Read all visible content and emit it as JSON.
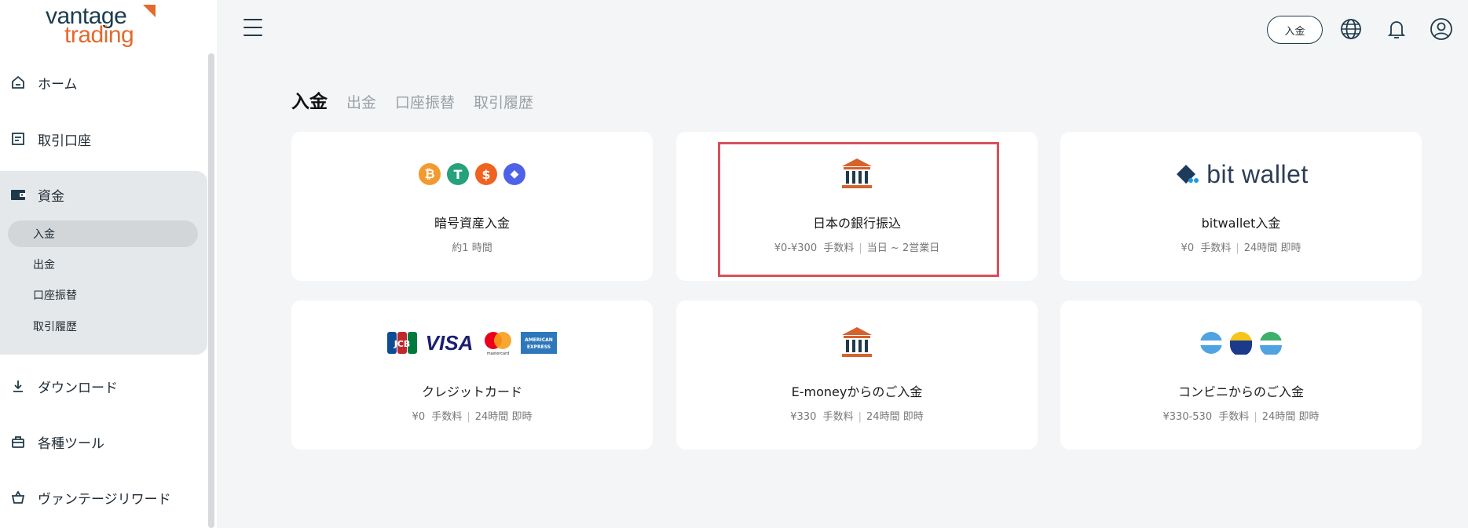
{
  "logo": {
    "line1": "vantage",
    "line2": "trading"
  },
  "sidebar": {
    "items": [
      {
        "label": "ホーム",
        "icon": "home-icon"
      },
      {
        "label": "取引口座",
        "icon": "account-icon"
      },
      {
        "label": "資金",
        "icon": "wallet-icon"
      },
      {
        "label": "ダウンロード",
        "icon": "download-icon"
      },
      {
        "label": "各種ツール",
        "icon": "toolbox-icon"
      },
      {
        "label": "ヴァンテージリワード",
        "icon": "basket-icon"
      }
    ],
    "sub_items": [
      {
        "label": "入金",
        "active": true
      },
      {
        "label": "出金",
        "active": false
      },
      {
        "label": "口座振替",
        "active": false
      },
      {
        "label": "取引履歴",
        "active": false
      }
    ]
  },
  "header": {
    "deposit_button": "入金",
    "icons": [
      "menu-icon",
      "globe-icon",
      "bell-icon",
      "user-icon"
    ]
  },
  "tabs": [
    {
      "label": "入金",
      "active": true
    },
    {
      "label": "出金",
      "active": false
    },
    {
      "label": "口座振替",
      "active": false
    },
    {
      "label": "取引履歴",
      "active": false
    }
  ],
  "cards": [
    {
      "title": "暗号資産入金",
      "fee": "",
      "fee_label": "",
      "time": "約1 時間",
      "icon": "crypto-icons"
    },
    {
      "title": "日本の銀行振込",
      "fee": "¥0-¥300",
      "fee_label": "手数料",
      "time": "当日 ~ 2営業日",
      "icon": "bank-icon",
      "selected": true
    },
    {
      "title": "bitwallet入金",
      "fee": "¥0",
      "fee_label": "手数料",
      "time": "24時間  即時",
      "icon": "bitwallet-logo",
      "logo_text_bit": "bit",
      "logo_text_wallet": "wallet"
    },
    {
      "title": "クレジットカード",
      "fee": "¥0",
      "fee_label": "手数料",
      "time": "24時間  即時",
      "icon": "credit-card-icons",
      "logos": {
        "jcb": "JCB",
        "visa": "VISA",
        "mastercard": "mastercard",
        "amex": "AMERICAN EXPRESS"
      }
    },
    {
      "title": "E-moneyからのご入金",
      "fee": "¥330",
      "fee_label": "手数料",
      "time": "24時間  即時",
      "icon": "bank-icon"
    },
    {
      "title": "コンビニからのご入金",
      "fee": "¥330-530",
      "fee_label": "手数料",
      "time": "24時間  即時",
      "icon": "convenience-store-icons"
    }
  ],
  "colors": {
    "accent": "#e36a2d",
    "dark": "#1f3b4a",
    "highlight": "#d9505b",
    "bank": "#d6622c"
  }
}
